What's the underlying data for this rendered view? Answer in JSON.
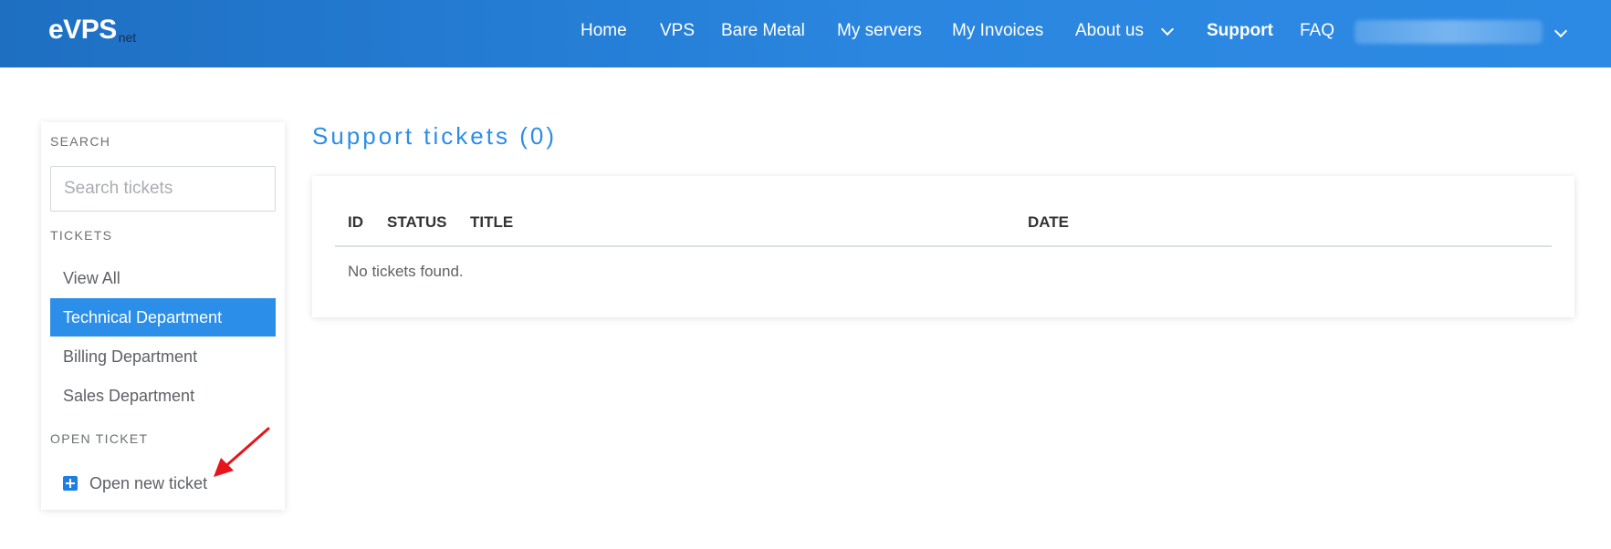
{
  "brand": {
    "logo_main": "eVPS",
    "logo_sub": "net"
  },
  "nav": {
    "items": [
      {
        "label": "Home"
      },
      {
        "label": "VPS"
      },
      {
        "label": "Bare Metal"
      },
      {
        "label": "My servers"
      },
      {
        "label": "My Invoices"
      },
      {
        "label": "About us"
      },
      {
        "label": "Support"
      },
      {
        "label": "FAQ"
      }
    ],
    "active": "Support"
  },
  "sidebar": {
    "search_heading": "SEARCH",
    "search_placeholder": "Search tickets",
    "search_value": "",
    "tickets_heading": "TICKETS",
    "items": [
      {
        "label": "View All"
      },
      {
        "label": "Technical Department"
      },
      {
        "label": "Billing Department"
      },
      {
        "label": "Sales Department"
      }
    ],
    "active_item": "Technical Department",
    "open_ticket_heading": "OPEN TICKET",
    "open_ticket_label": "Open new ticket"
  },
  "main": {
    "title": "Support tickets (0)",
    "table": {
      "columns": [
        "ID",
        "STATUS",
        "TITLE",
        "DATE"
      ],
      "rows": [],
      "empty_message": "No tickets found."
    }
  },
  "colors": {
    "header_start": "#1e6fc2",
    "header_end": "#2d8ae4",
    "accent": "#2b8ee8",
    "annotation_arrow": "#e8141b"
  },
  "icons": [
    "chevron-down-icon",
    "user-menu-chevron-icon",
    "plus-square-icon",
    "annotation-arrow-icon"
  ]
}
